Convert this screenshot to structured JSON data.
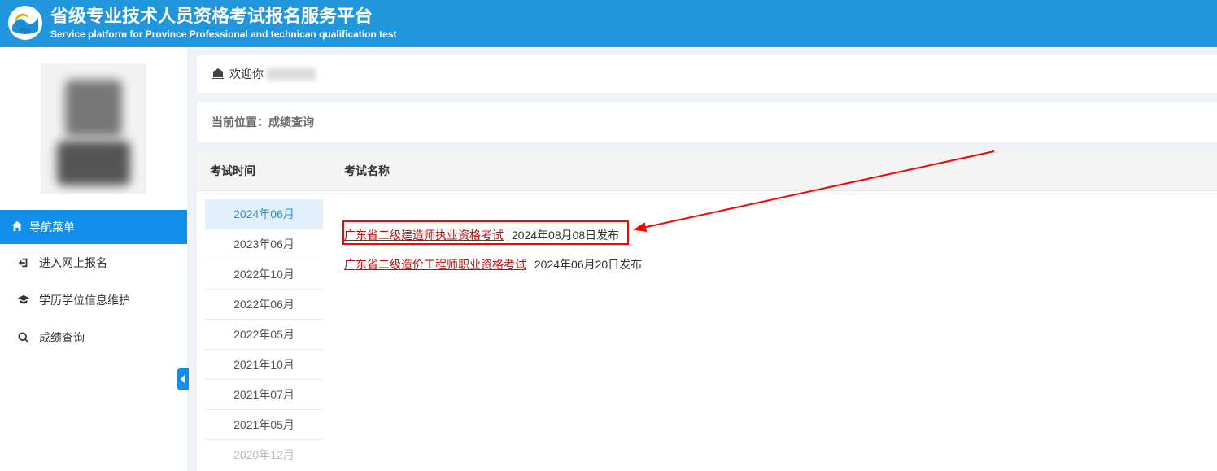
{
  "header": {
    "title_cn": "省级专业技术人员资格考试报名服务平台",
    "title_en": "Service platform for Province Professional and technican qualification test"
  },
  "nav": {
    "section_label": "导航菜单",
    "items": [
      {
        "label": "进入网上报名",
        "icon": "login-icon"
      },
      {
        "label": "学历学位信息维护",
        "icon": "graduation-icon"
      },
      {
        "label": "成绩查询",
        "icon": "search-icon"
      }
    ]
  },
  "welcome": {
    "prefix": "欢迎你"
  },
  "breadcrumb": {
    "label": "当前位置：",
    "current": "成绩查询"
  },
  "table": {
    "time_header": "考试时间",
    "name_header": "考试名称",
    "dates": [
      {
        "label": "2024年06月",
        "active": true
      },
      {
        "label": "2023年06月",
        "active": false
      },
      {
        "label": "2022年10月",
        "active": false
      },
      {
        "label": "2022年06月",
        "active": false
      },
      {
        "label": "2022年05月",
        "active": false
      },
      {
        "label": "2021年10月",
        "active": false
      },
      {
        "label": "2021年07月",
        "active": false
      },
      {
        "label": "2021年05月",
        "active": false
      },
      {
        "label": "2020年12月",
        "active": false
      }
    ],
    "exams": [
      {
        "link_text": "广东省二级建造师执业资格考试",
        "published": "2024年08月08日发布",
        "highlight": true
      },
      {
        "link_text": "广东省二级造价工程师职业资格考试",
        "published": "2024年06月20日发布",
        "highlight": false
      }
    ]
  }
}
